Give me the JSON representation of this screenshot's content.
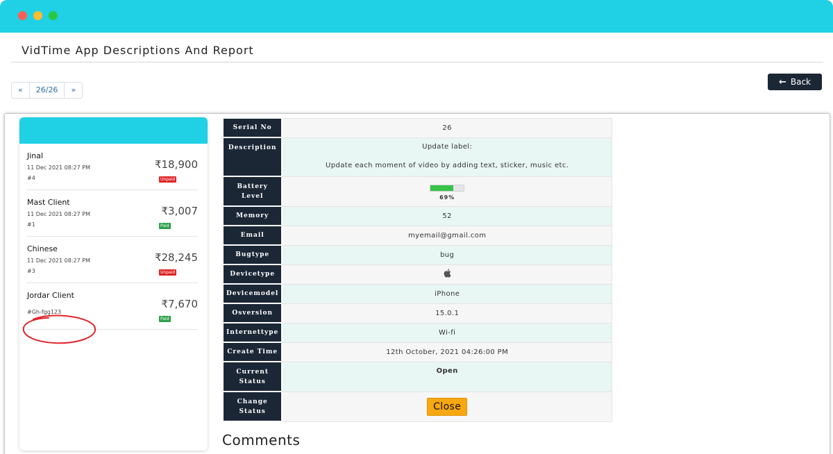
{
  "window": {
    "title": "VidTime App Descriptions And Report"
  },
  "pager": {
    "prev": "«",
    "current": "26/26",
    "next": "»"
  },
  "toolbar": {
    "back_label": "Back",
    "back_icon": "arrow-left-icon"
  },
  "clients": [
    {
      "name": "Jinal",
      "date": "11 Dec 2021 08:27 PM",
      "ref": "#4",
      "amount": "₹18,900",
      "status": "Unpaid"
    },
    {
      "name": "Mast Client",
      "date": "11 Dec 2021 08:27 PM",
      "ref": "#1",
      "amount": "₹3,007",
      "status": "Paid"
    },
    {
      "name": "Chinese",
      "date": "11 Dec 2021 08:27 PM",
      "ref": "#3",
      "amount": "₹28,245",
      "status": "Unpaid"
    },
    {
      "name": "Jordar Client",
      "date": "",
      "ref": "#Gh-fgg123",
      "amount": "₹7,670",
      "status": "Paid"
    }
  ],
  "details": {
    "serial_label": "Serial No",
    "serial": "26",
    "description_label": "Description",
    "description_title": "Update label:",
    "description_body": "Update each moment of video by adding text, sticker, music etc.",
    "battery_label": "Battery Level",
    "battery_percent": "69%",
    "battery_fraction": 0.69,
    "memory_label": "Memory",
    "memory": "52",
    "email_label": "Email",
    "email": "myemail@gmail.com",
    "bugtype_label": "Bugtype",
    "bugtype": "bug",
    "devicetype_label": "Devicetype",
    "devicetype_icon": "apple-icon",
    "devicemodel_label": "Devicemodel",
    "devicemodel": "iPhone",
    "osversion_label": "Osversion",
    "osversion": "15.0.1",
    "internettype_label": "Internettype",
    "internettype": "Wi-fi",
    "createtime_label": "Create Time",
    "createtime": "12th October, 2021 04:26:00 PM",
    "status_label": "Current Status",
    "status": "Open",
    "change_label": "Change Status",
    "change_button": "Close"
  },
  "comments": {
    "heading": "Comments"
  },
  "colors": {
    "accent": "#20d0e4",
    "dark": "#1c2736",
    "unpaid": "#e02424",
    "paid": "#2ea14a",
    "close_button": "#f6a712"
  }
}
